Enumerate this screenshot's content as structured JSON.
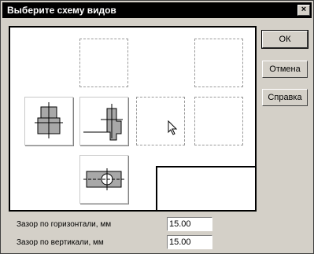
{
  "dialog": {
    "title": "Выберите схему видов",
    "close_glyph": "×"
  },
  "buttons": {
    "ok": "ОК",
    "cancel": "Отмена",
    "help": "Справка"
  },
  "fields": {
    "horizontal_gap_label": "Зазор по горизонтали, мм",
    "horizontal_gap_value": "15.00",
    "vertical_gap_label": "Зазор по вертикали, мм",
    "vertical_gap_value": "15.00"
  },
  "icons": {
    "close": "close-icon",
    "cursor": "mouse-pointer-icon",
    "view_left": "side-view-icon",
    "view_front": "front-view-icon",
    "view_top": "top-view-icon"
  }
}
